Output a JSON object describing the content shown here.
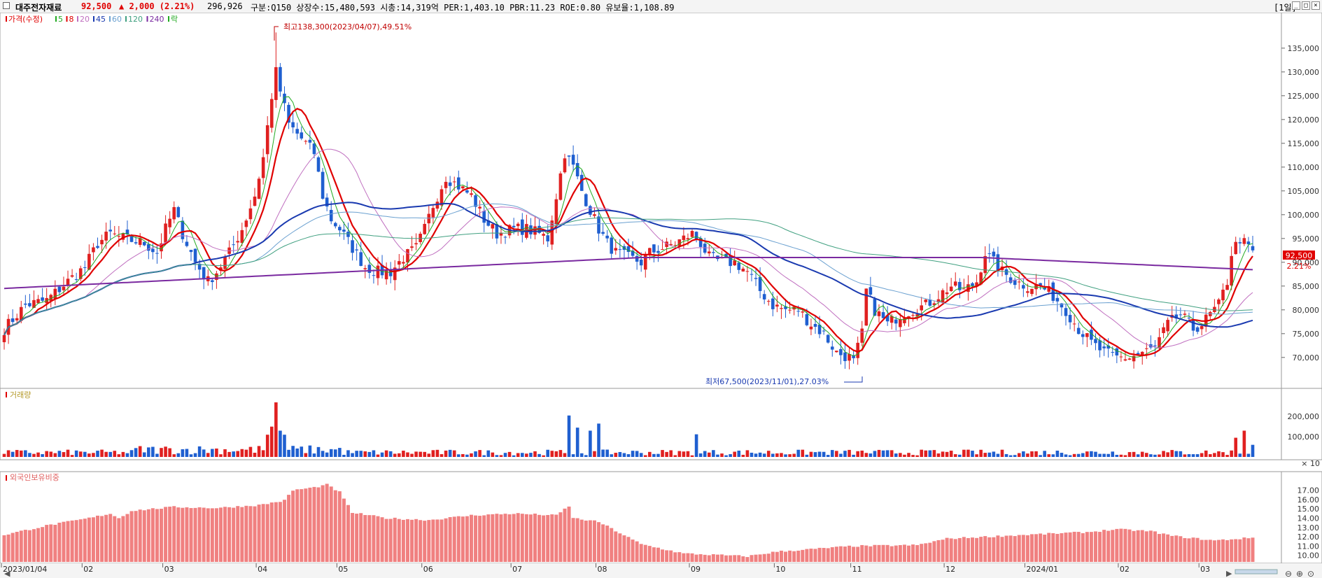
{
  "header": {
    "name": "대주전자재료",
    "price": "92,500",
    "change": "▲ 2,000 (2.21%)",
    "volume": "296,926",
    "info": "구분:Q150 상장수:15,480,593 시총:14,319억 PER:1,403.10 PBR:11.23 ROE:0.80 유보율:1,108.89",
    "period": "[1일]"
  },
  "legend": {
    "items": [
      {
        "label": "가격(수정)",
        "color": "#e00000"
      },
      {
        "label": "5",
        "color": "#22aa22"
      },
      {
        "label": "8",
        "color": "#e00000"
      },
      {
        "label": "20",
        "color": "#c070c0"
      },
      {
        "label": "45",
        "color": "#1a3ab0"
      },
      {
        "label": "60",
        "color": "#6aa0d0"
      },
      {
        "label": "120",
        "color": "#40a080"
      },
      {
        "label": "240",
        "color": "#7a2aa0"
      },
      {
        "label": "락",
        "color": "#22aa22"
      }
    ]
  },
  "annotations": {
    "high": "최고138,300(2023/04/07),49.51%",
    "low": "최저67,500(2023/11/01),27.03%"
  },
  "volume_panel": {
    "title": "거래량",
    "unit": "× 10"
  },
  "foreign_panel": {
    "title": "외국인보유비중"
  },
  "price_tag": {
    "price": "92,500",
    "pct": "2.21%"
  },
  "colors": {
    "up": "#e02020",
    "down": "#1f5fd0",
    "foreign": "#f08080",
    "accent": "#e00000"
  },
  "chart_data": [
    {
      "type": "candlestick",
      "title": "",
      "ylim": [
        66000,
        141000
      ],
      "yticks": [
        70000,
        75000,
        80000,
        85000,
        90000,
        95000,
        100000,
        105000,
        110000,
        115000,
        120000,
        125000,
        130000,
        135000
      ],
      "ytick_labels": [
        "70,000",
        "75,000",
        "80,000",
        "85,000",
        "90,000",
        "95,000",
        "100,000",
        "105,000",
        "110,000",
        "115,000",
        "120,000",
        "125,000",
        "130,000",
        "135,000"
      ],
      "x_labels": [
        {
          "label": "2023/01/04",
          "index": 0
        },
        {
          "label": "02",
          "index": 19
        },
        {
          "label": "03",
          "index": 38
        },
        {
          "label": "04",
          "index": 60
        },
        {
          "label": "05",
          "index": 79
        },
        {
          "label": "06",
          "index": 99
        },
        {
          "label": "07",
          "index": 120
        },
        {
          "label": "08",
          "index": 140
        },
        {
          "label": "09",
          "index": 162
        },
        {
          "label": "10",
          "index": 182
        },
        {
          "label": "11",
          "index": 200
        },
        {
          "label": "12",
          "index": 222
        },
        {
          "label": "2024/01",
          "index": 241
        },
        {
          "label": "02",
          "index": 263
        },
        {
          "label": "03",
          "index": 282
        }
      ],
      "close_anchors": [
        [
          0,
          76000
        ],
        [
          5,
          81000
        ],
        [
          10,
          82000
        ],
        [
          15,
          86000
        ],
        [
          19,
          89000
        ],
        [
          22,
          94000
        ],
        [
          25,
          96000
        ],
        [
          28,
          95000
        ],
        [
          33,
          94000
        ],
        [
          36,
          92000
        ],
        [
          38,
          97000
        ],
        [
          40,
          101000
        ],
        [
          42,
          96000
        ],
        [
          45,
          90000
        ],
        [
          48,
          86000
        ],
        [
          50,
          88000
        ],
        [
          53,
          92000
        ],
        [
          56,
          97000
        ],
        [
          59,
          104000
        ],
        [
          61,
          112000
        ],
        [
          63,
          125000
        ],
        [
          64,
          131000
        ],
        [
          65,
          126000
        ],
        [
          67,
          119000
        ],
        [
          70,
          116000
        ],
        [
          73,
          113000
        ],
        [
          75,
          104000
        ],
        [
          77,
          99000
        ],
        [
          79,
          97000
        ],
        [
          82,
          93000
        ],
        [
          85,
          89000
        ],
        [
          88,
          88000
        ],
        [
          91,
          88000
        ],
        [
          94,
          91000
        ],
        [
          97,
          93000
        ],
        [
          99,
          97000
        ],
        [
          101,
          102000
        ],
        [
          104,
          108000
        ],
        [
          107,
          106000
        ],
        [
          110,
          104000
        ],
        [
          113,
          99000
        ],
        [
          116,
          96000
        ],
        [
          120,
          97000
        ],
        [
          123,
          97000
        ],
        [
          126,
          96000
        ],
        [
          128,
          95000
        ],
        [
          130,
          104000
        ],
        [
          132,
          113000
        ],
        [
          134,
          110000
        ],
        [
          136,
          105000
        ],
        [
          138,
          101000
        ],
        [
          140,
          97000
        ],
        [
          142,
          94000
        ],
        [
          144,
          92000
        ],
        [
          147,
          91000
        ],
        [
          150,
          90000
        ],
        [
          152,
          92000
        ],
        [
          155,
          93000
        ],
        [
          158,
          94000
        ],
        [
          160,
          95000
        ],
        [
          162,
          96000
        ],
        [
          164,
          94000
        ],
        [
          166,
          91000
        ],
        [
          169,
          90000
        ],
        [
          172,
          90000
        ],
        [
          175,
          88000
        ],
        [
          178,
          84000
        ],
        [
          181,
          81000
        ],
        [
          184,
          80000
        ],
        [
          187,
          80000
        ],
        [
          190,
          77000
        ],
        [
          193,
          75000
        ],
        [
          196,
          71000
        ],
        [
          199,
          70000
        ],
        [
          200,
          69000
        ],
        [
          202,
          75000
        ],
        [
          203,
          84000
        ],
        [
          205,
          80000
        ],
        [
          208,
          77000
        ],
        [
          211,
          79000
        ],
        [
          214,
          80000
        ],
        [
          217,
          81000
        ],
        [
          220,
          83000
        ],
        [
          223,
          85000
        ],
        [
          226,
          84000
        ],
        [
          229,
          86000
        ],
        [
          231,
          92000
        ],
        [
          233,
          90000
        ],
        [
          235,
          88000
        ],
        [
          238,
          86000
        ],
        [
          241,
          85000
        ],
        [
          244,
          85000
        ],
        [
          247,
          83000
        ],
        [
          250,
          80000
        ],
        [
          253,
          76000
        ],
        [
          256,
          73000
        ],
        [
          259,
          71000
        ],
        [
          262,
          70000
        ],
        [
          265,
          70000
        ],
        [
          268,
          71000
        ],
        [
          271,
          72000
        ],
        [
          274,
          77000
        ],
        [
          277,
          79000
        ],
        [
          280,
          76000
        ],
        [
          282,
          77000
        ],
        [
          284,
          79000
        ],
        [
          286,
          81000
        ],
        [
          288,
          86000
        ],
        [
          289,
          92000
        ],
        [
          291,
          95000
        ],
        [
          293,
          93000
        ],
        [
          294,
          92500
        ]
      ],
      "candle_count": 295,
      "seed": 7,
      "moving_averages": [
        {
          "period": 5,
          "color": "#22aa22",
          "width": 1
        },
        {
          "period": 8,
          "color": "#e00000",
          "width": 2.2
        },
        {
          "period": 20,
          "color": "#c070c0",
          "width": 1
        },
        {
          "period": 45,
          "color": "#1a3ab0",
          "width": 2
        },
        {
          "period": 60,
          "color": "#6aa0d0",
          "width": 1
        },
        {
          "period": 120,
          "color": "#40a080",
          "width": 1
        },
        {
          "period": 240,
          "color": "#7a2aa0",
          "width": 2
        }
      ],
      "high_point": {
        "index": 64,
        "value": 138300
      },
      "low_point": {
        "index": 199,
        "value": 67500
      }
    },
    {
      "type": "bar",
      "title": "거래량",
      "ylim": [
        0,
        270000
      ],
      "yticks": [
        100000,
        200000
      ],
      "ytick_labels": [
        "100,000",
        "200,000"
      ],
      "spikes": [
        [
          62,
          110000
        ],
        [
          64,
          270000
        ],
        [
          63,
          150000
        ],
        [
          65,
          130000
        ],
        [
          66,
          110000
        ],
        [
          133,
          205000
        ],
        [
          135,
          145000
        ],
        [
          138,
          130000
        ],
        [
          140,
          165000
        ],
        [
          163,
          112000
        ],
        [
          290,
          95000
        ],
        [
          292,
          130000
        ],
        [
          294,
          60000
        ]
      ],
      "base": 26000
    },
    {
      "type": "bar",
      "title": "외국인보유비중",
      "ylim": [
        9.3,
        18.1
      ],
      "yticks": [
        10,
        11,
        12,
        13,
        14,
        15,
        16,
        17
      ],
      "ytick_labels": [
        "10.00",
        "11.00",
        "12.00",
        "13.00",
        "14.00",
        "15.00",
        "16.00",
        "17.00"
      ],
      "anchors": [
        [
          0,
          12.2
        ],
        [
          10,
          13.2
        ],
        [
          20,
          14.0
        ],
        [
          25,
          14.5
        ],
        [
          27,
          14.0
        ],
        [
          30,
          14.8
        ],
        [
          40,
          15.2
        ],
        [
          50,
          15.1
        ],
        [
          60,
          15.4
        ],
        [
          66,
          15.9
        ],
        [
          68,
          17.0
        ],
        [
          73,
          17.3
        ],
        [
          76,
          17.6
        ],
        [
          79,
          16.8
        ],
        [
          82,
          14.6
        ],
        [
          90,
          14.0
        ],
        [
          100,
          13.8
        ],
        [
          110,
          14.3
        ],
        [
          120,
          14.5
        ],
        [
          130,
          14.3
        ],
        [
          133,
          15.3
        ],
        [
          134,
          14.0
        ],
        [
          140,
          13.6
        ],
        [
          150,
          11.2
        ],
        [
          160,
          10.2
        ],
        [
          175,
          9.9
        ],
        [
          182,
          10.4
        ],
        [
          200,
          11.0
        ],
        [
          215,
          11.1
        ],
        [
          222,
          11.8
        ],
        [
          240,
          12.2
        ],
        [
          255,
          12.5
        ],
        [
          262,
          12.8
        ],
        [
          270,
          12.6
        ],
        [
          275,
          12.1
        ],
        [
          285,
          11.6
        ],
        [
          294,
          11.9
        ]
      ]
    }
  ]
}
